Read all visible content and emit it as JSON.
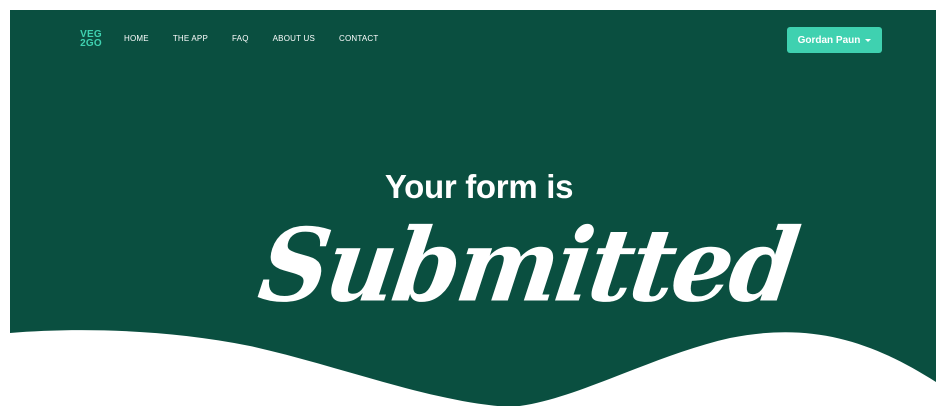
{
  "logo": {
    "line1": "VEG",
    "line2": "2GO"
  },
  "nav": {
    "items": [
      {
        "label": "HOME"
      },
      {
        "label": "THE APP"
      },
      {
        "label": "FAQ"
      },
      {
        "label": "ABOUT US"
      },
      {
        "label": "CONTACT"
      }
    ]
  },
  "user_menu": {
    "name": "Gordan Paun",
    "icon": "chevron-down-icon"
  },
  "hero": {
    "heading": "Your form is",
    "script_text": "Submitted"
  },
  "colors": {
    "background": "#0a4f40",
    "accent": "#3fd1b0",
    "text": "#ffffff",
    "wave": "#ffffff"
  }
}
